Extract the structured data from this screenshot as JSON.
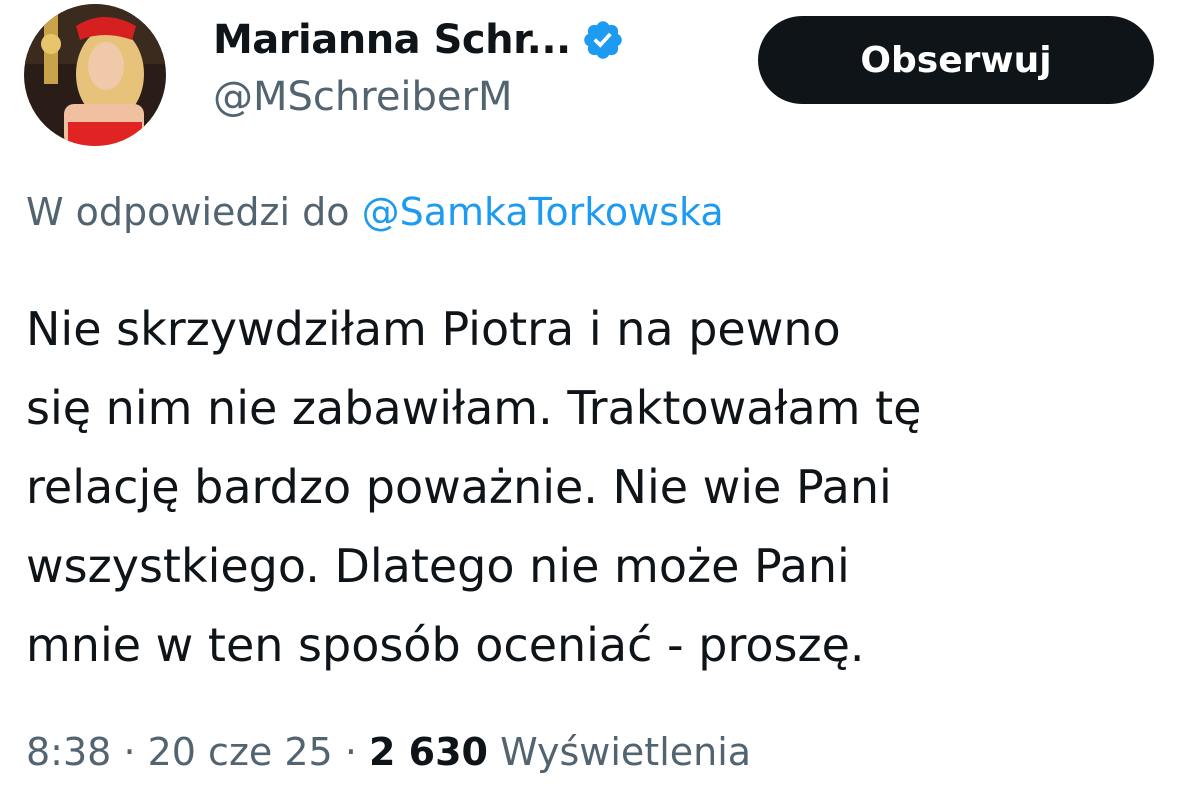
{
  "author": {
    "display_name": "Marianna Schr...",
    "handle": "@MSchreiberM",
    "verified_icon": "verified-badge-icon",
    "avatar": "profile-photo"
  },
  "follow_button": {
    "label": "Obserwuj"
  },
  "reply_context": {
    "prefix": "W odpowiedzi do",
    "mention": "@SamkaTorkowska"
  },
  "tweet": {
    "lines": [
      "Nie skrzywdziłam Piotra i na pewno",
      "się nim nie zabawiłam. Traktowałam tę",
      "relację bardzo poważnie. Nie wie Pani",
      "wszystkiego. Dlatego nie może Pani",
      "mnie w ten sposób oceniać - proszę."
    ]
  },
  "meta": {
    "time": "8:38",
    "separator": "·",
    "date": "20 cze 25",
    "views_count": "2 630",
    "views_label": "Wyświetlenia"
  },
  "colors": {
    "text": "#0f1419",
    "secondary": "#536471",
    "accent": "#1d9bf0",
    "button_bg": "#0f1419"
  }
}
